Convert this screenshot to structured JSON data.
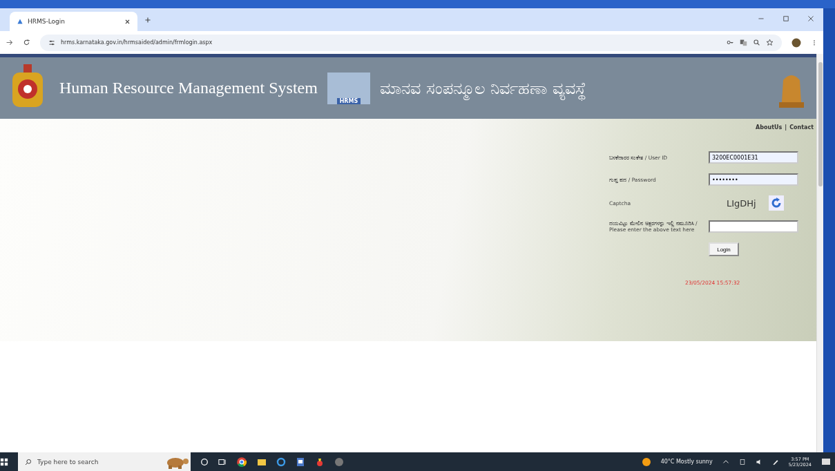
{
  "browser": {
    "tab": {
      "title": "HRMS-Login",
      "selected": true
    },
    "url": "hrms.karnataka.gov.in/hrmsaided/admin/frmlogin.aspx"
  },
  "header": {
    "title": "Human Resource Management System",
    "logo_text": "HRMS",
    "title_kannada": "ಮಾನವ ಸಂಪನ್ಮೂಲ ನಿರ್ವಹಣಾ ವ್ಯವಸ್ಥೆ"
  },
  "top_links": [
    "AboutUs",
    "|",
    "Contact"
  ],
  "login": {
    "user_label": "ಬಳಕೆದಾರರ ಸಂಕೇತ / User ID",
    "user_value": "3200EC0001E31",
    "password_label": "ಗುಪ್ತ ಪದ / Password",
    "password_value": "••••••••",
    "captcha_label": "Captcha",
    "captcha_text": "LIgDHj",
    "captcha_input_label": "ದಯವಿಟ್ಟು ಮೇಲಿನ ಅಕ್ಷರಗಳನ್ನು ಇಲ್ಲಿ ನಮೂದಿಸಿ / Please enter the above text here",
    "button": "Login",
    "timestamp": "23/05/2024 15:57:32"
  },
  "taskbar": {
    "search_placeholder": "Type here to search",
    "weather": "40°C  Mostly sunny",
    "time": "3:57 PM",
    "date": "5/23/2024"
  }
}
